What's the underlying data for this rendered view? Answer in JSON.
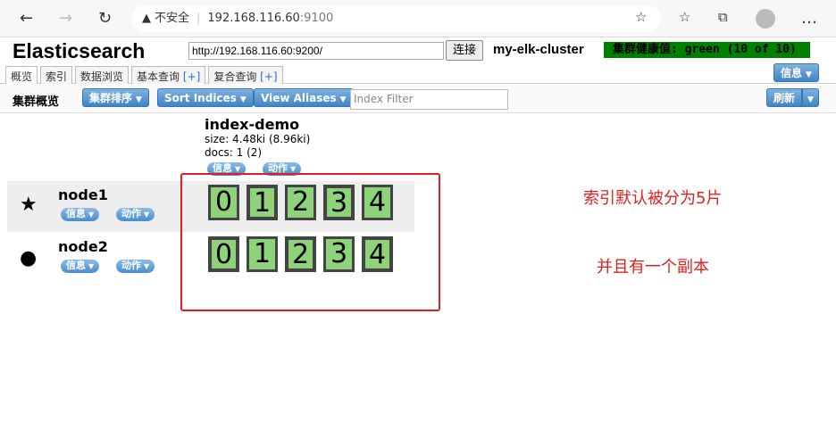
{
  "browser": {
    "security_label": "不安全",
    "url_host": "192.168.116.60",
    "url_port": ":9100",
    "icons": [
      "back-icon",
      "forward-icon",
      "reload-icon",
      "warning-icon",
      "favorite-add-icon",
      "favorites-icon",
      "collections-icon",
      "profile-icon",
      "more-icon"
    ]
  },
  "header": {
    "title": "Elasticsearch",
    "connect_url": "http://192.168.116.60:9200/",
    "connect_label": "连接",
    "cluster_name": "my-elk-cluster",
    "health": "集群健康值: green (10 of 10)",
    "health_color": "#008000"
  },
  "tabs": [
    {
      "label": "概览",
      "active": true
    },
    {
      "label": "索引"
    },
    {
      "label": "数据浏览"
    },
    {
      "label": "基本查询",
      "plus": "[+]"
    },
    {
      "label": "复合查询",
      "plus": "[+]"
    }
  ],
  "info_label": "信息",
  "toolbar": {
    "label": "集群概览",
    "sort_cluster": "集群排序",
    "sort_indices": "Sort Indices",
    "view_aliases": "View Aliases",
    "filter_placeholder": "Index Filter",
    "refresh": "刷新"
  },
  "index": {
    "name": "index-demo",
    "size": "size: 4.48ki (8.96ki)",
    "docs": "docs: 1 (2)",
    "info": "信息",
    "action": "动作"
  },
  "nodes": [
    {
      "name": "node1",
      "icon": "star-icon",
      "info": "信息",
      "action": "动作",
      "shards": [
        "0",
        "1",
        "2",
        "3",
        "4"
      ]
    },
    {
      "name": "node2",
      "icon": "circle-icon",
      "info": "信息",
      "action": "动作",
      "shards": [
        "0",
        "1",
        "2",
        "3",
        "4"
      ]
    }
  ],
  "annotations": {
    "note1": "索引默认被分为5片",
    "note2": "并且有一个副本",
    "highlight_color": "#e02020"
  }
}
